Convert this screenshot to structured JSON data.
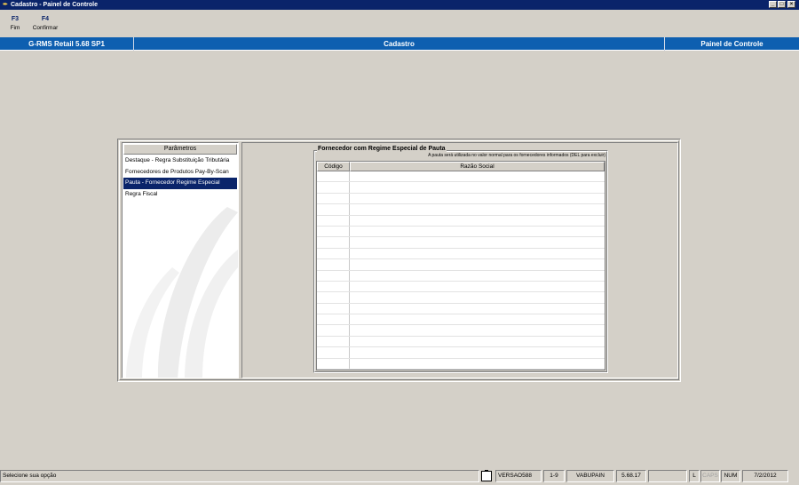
{
  "window": {
    "title": "Cadastro - Painel de Controle",
    "icon": "app-icon",
    "controls": [
      "minimize",
      "maximize",
      "close"
    ]
  },
  "toolbar": {
    "fkeys": [
      {
        "key": "F3",
        "label": "Fim"
      },
      {
        "key": "F4",
        "label": "Confirmar"
      }
    ]
  },
  "header": {
    "left": "G-RMS Retail 5.68 SP1",
    "center": "Cadastro",
    "right": "Painel de Controle",
    "color": "#0e5fb0"
  },
  "parametros": {
    "header": "Parâmetros",
    "items": [
      "Destaque - Regra Substituição Tributária",
      "Fornecedores de Produtos Pay-By-Scan",
      "Pauta - Fornecedor Regime Especial",
      "Regra Fiscal"
    ],
    "selected_index": 2
  },
  "groupbox": {
    "title": "Fornecedor com Regime Especial de Pauta",
    "subtitle": "A pauta será utilizada no valor normal para os fornecedores informados (DEL para excluir)"
  },
  "grid": {
    "columns": [
      "Código",
      "Razão Social"
    ],
    "rows": [
      [
        "",
        ""
      ],
      [
        "",
        ""
      ],
      [
        "",
        ""
      ],
      [
        "",
        ""
      ],
      [
        "",
        ""
      ],
      [
        "",
        ""
      ],
      [
        "",
        ""
      ],
      [
        "",
        ""
      ],
      [
        "",
        ""
      ],
      [
        "",
        ""
      ],
      [
        "",
        ""
      ],
      [
        "",
        ""
      ],
      [
        "",
        ""
      ],
      [
        "",
        ""
      ],
      [
        "",
        ""
      ],
      [
        "",
        ""
      ],
      [
        "",
        ""
      ],
      [
        "",
        ""
      ]
    ]
  },
  "statusbar": {
    "message": "Selecione sua opção",
    "version_db": "VERSAO588",
    "page": "1-9",
    "user": "VABUPAIN",
    "build": "5.68.17",
    "empty": "",
    "l_indicator": "L",
    "caps": "CAPS",
    "num": "NUM",
    "date": "7/2/2012"
  },
  "colors": {
    "title_bar": "#0a246a",
    "selection": "#0a246a",
    "background": "#d4d0c8"
  }
}
